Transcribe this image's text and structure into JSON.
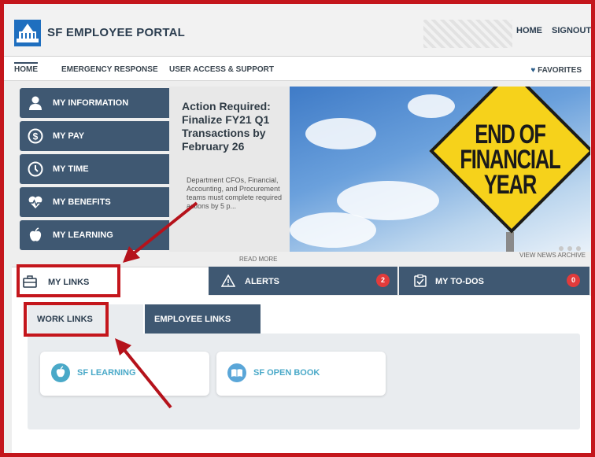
{
  "header": {
    "brand": "SF EMPLOYEE PORTAL",
    "nav": [
      "HOME",
      "SIGNOUT"
    ]
  },
  "top_tabs": [
    "HOME",
    "EMERGENCY RESPONSE",
    "USER ACCESS & SUPPORT"
  ],
  "favorites": "FAVORITES",
  "sidebar": [
    {
      "label": "MY INFORMATION",
      "icon": "person-icon"
    },
    {
      "label": "MY PAY",
      "icon": "dollar-icon"
    },
    {
      "label": "MY TIME",
      "icon": "clock-icon"
    },
    {
      "label": "MY BENEFITS",
      "icon": "heart-pulse-icon"
    },
    {
      "label": "MY LEARNING",
      "icon": "apple-icon"
    }
  ],
  "news": {
    "title": "Action Required: Finalize FY21 Q1 Transactions by February 26",
    "body": "Department CFOs, Financial, Accounting, and Procurement teams must complete required actions by 5 p...",
    "read_more": "READ MORE",
    "archive": "VIEW NEWS ARCHIVE"
  },
  "hero": {
    "sign_lines": [
      "END OF",
      "FINANCIAL",
      "YEAR"
    ]
  },
  "bottom_tabs": [
    {
      "label": "MY LINKS",
      "icon": "briefcase-icon"
    },
    {
      "label": "ALERTS",
      "icon": "warning-icon",
      "badge": "2"
    },
    {
      "label": "MY TO-DOS",
      "icon": "checklist-icon",
      "badge": "0"
    }
  ],
  "sub_tabs": [
    "WORK LINKS",
    "EMPLOYEE LINKS"
  ],
  "links": [
    {
      "label": "SF LEARNING",
      "icon": "apple-icon"
    },
    {
      "label": "SF OPEN BOOK",
      "icon": "book-icon"
    }
  ],
  "colors": {
    "nav_dark": "#3f5872",
    "highlight": "#c4161c",
    "badge": "#e23b3b",
    "link_teal": "#4aa9c8"
  }
}
